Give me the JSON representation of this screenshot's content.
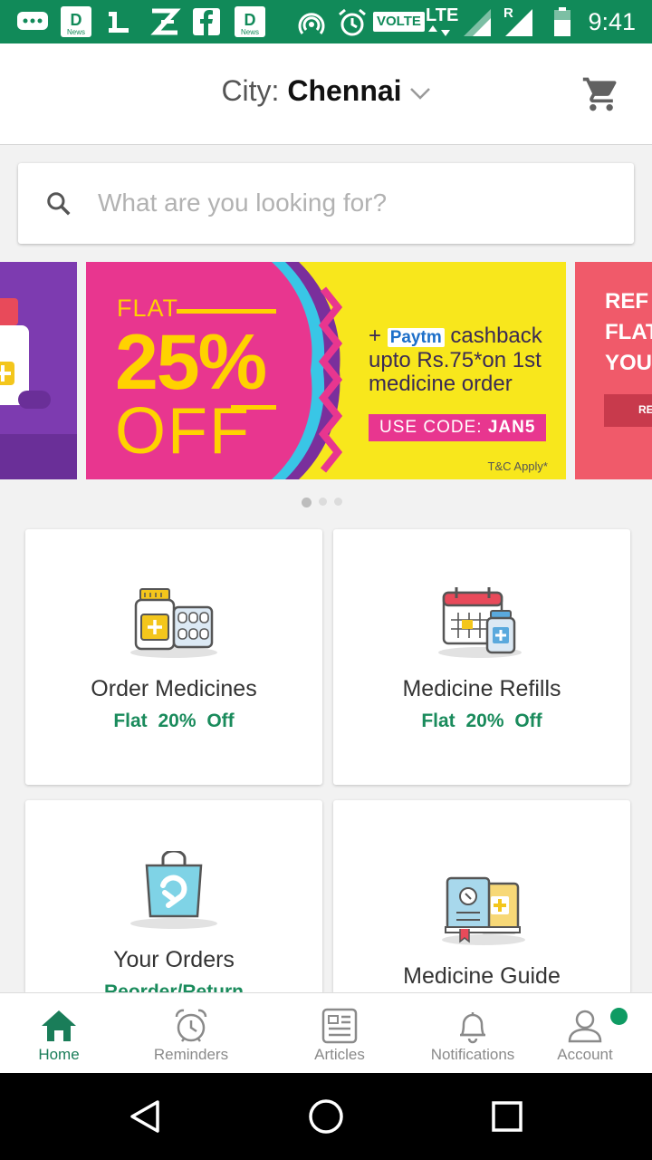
{
  "status_bar": {
    "time": "9:41",
    "volte": "VOLTE",
    "lte": "LTE",
    "roaming": "R",
    "news_badge": "News",
    "icons": [
      "chat-icon",
      "news-app-icon",
      "app-1-icon",
      "zee-icon",
      "facebook-icon",
      "news-app-icon",
      "hotspot-icon",
      "alarm-icon",
      "volte-icon",
      "lte-icon",
      "signal-icon",
      "battery-icon"
    ]
  },
  "header": {
    "city_prefix": "City: ",
    "city_name": "Chennai"
  },
  "search": {
    "placeholder": "What are you looking for?"
  },
  "banner": {
    "flat": "FLAT",
    "percent": "25%",
    "off": "OFF",
    "plus": "+",
    "paytm": "Paytm",
    "cashback": "cashback",
    "line2": "upto Rs.75*on 1st",
    "line3": "medicine order",
    "code_prefix": "USE CODE:",
    "code": "JAN5",
    "tc": "T&C Apply*",
    "right_line1": "REF",
    "right_line2": "FLAT",
    "right_line3": "YOU",
    "right_button": "RE"
  },
  "carousel": {
    "count": 3,
    "active_index": 0
  },
  "cards": [
    {
      "title": "Order Medicines",
      "subtitle": "Flat  20% Off",
      "icon": "medicine-bottle-icon"
    },
    {
      "title": "Medicine Refills",
      "subtitle": "Flat  20% Off",
      "icon": "calendar-refill-icon"
    },
    {
      "title": "Your Orders",
      "subtitle": "Reorder/Return",
      "icon": "shopping-bag-icon"
    },
    {
      "title": "Medicine Guide",
      "subtitle": "",
      "icon": "medicine-book-icon"
    }
  ],
  "bottom_nav": [
    {
      "label": "Home",
      "icon": "home-icon",
      "active": true
    },
    {
      "label": "Reminders",
      "icon": "alarm-clock-icon",
      "active": false
    },
    {
      "label": "Articles",
      "icon": "articles-icon",
      "active": false
    },
    {
      "label": "Notifications",
      "icon": "bell-icon",
      "active": false
    },
    {
      "label": "Account",
      "icon": "user-icon",
      "active": false
    }
  ],
  "colors": {
    "brand_green": "#118a59",
    "accent_green": "#1a8b5c",
    "banner_pink": "#e8368f",
    "banner_yellow": "#f8e71c"
  }
}
